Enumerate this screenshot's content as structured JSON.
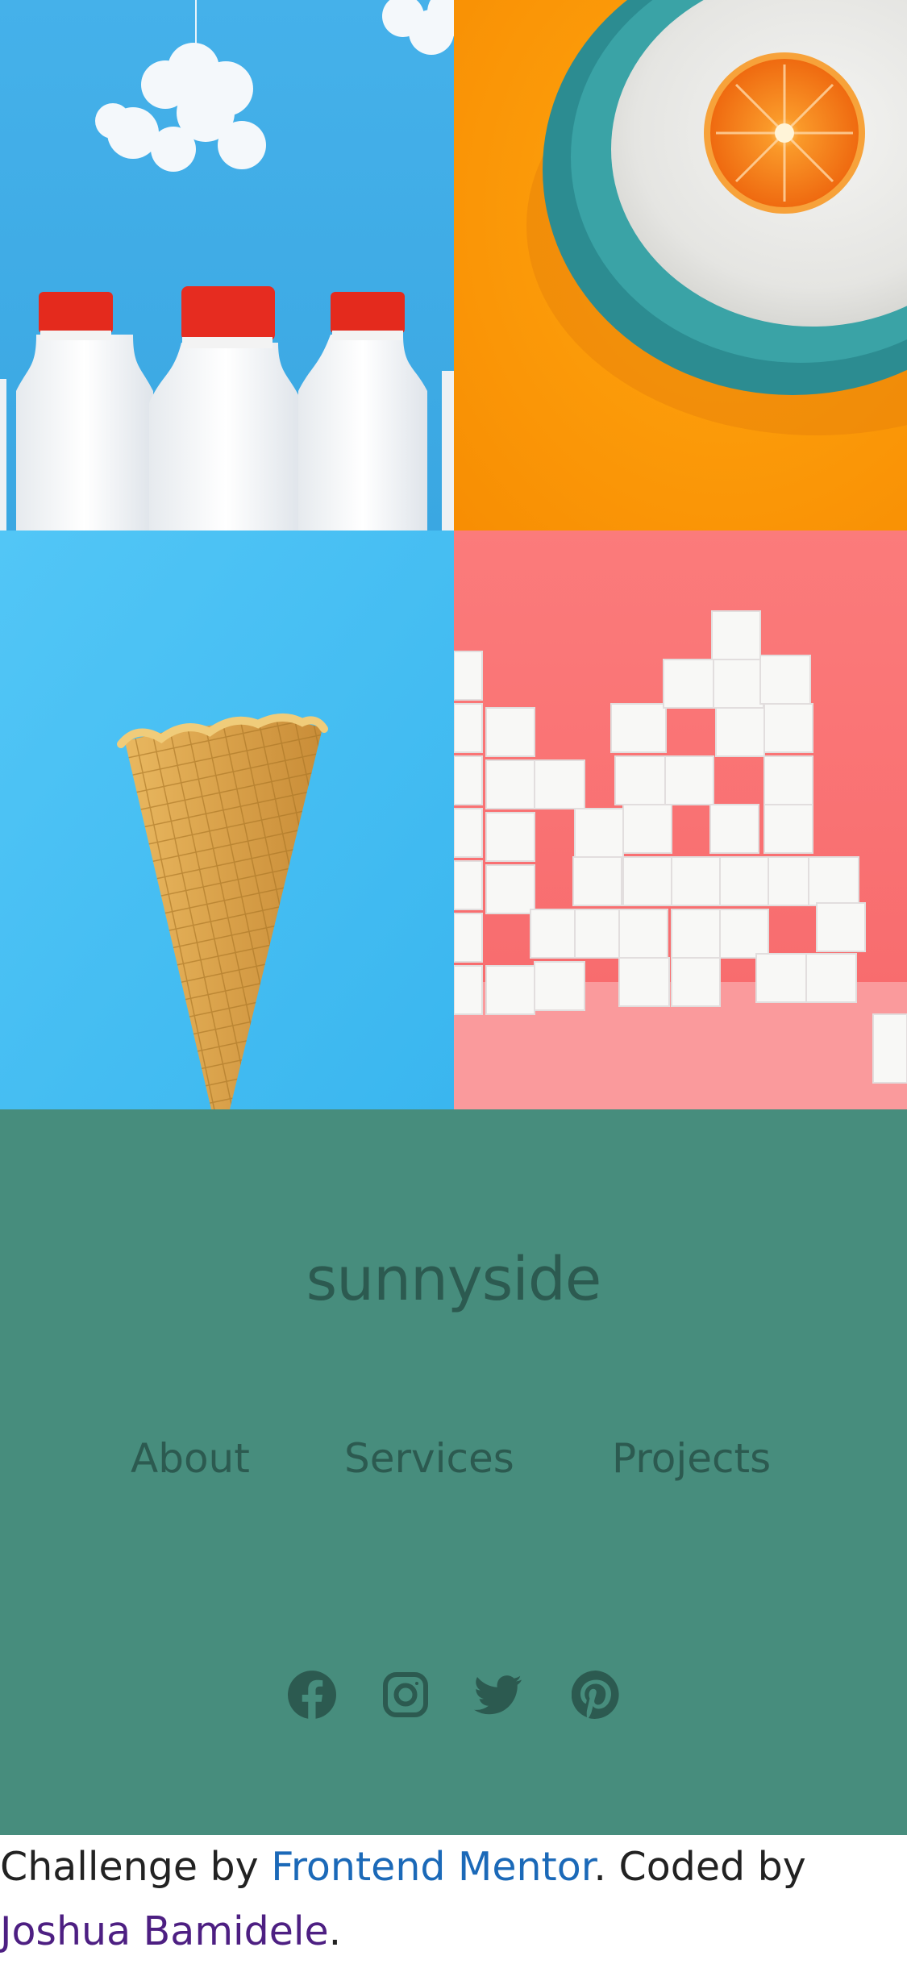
{
  "gallery": {
    "tiles": [
      {
        "name": "milk-bottles",
        "bg": "#3eaee8"
      },
      {
        "name": "orange",
        "bg": "#fb9a05"
      },
      {
        "name": "ice-cream-cone",
        "bg": "#4ac0f3"
      },
      {
        "name": "sugar-cubes",
        "bg": "#fa7878"
      }
    ]
  },
  "footer": {
    "bg": "#478d7d",
    "brand": "sunnyside",
    "nav": [
      "About",
      "Services",
      "Projects"
    ],
    "socials": [
      "facebook-icon",
      "instagram-icon",
      "twitter-icon",
      "pinterest-icon"
    ]
  },
  "attribution": {
    "prefix": "Challenge by ",
    "fm_link": "Frontend Mentor",
    "middle": ". Coded by ",
    "author_link": "Joshua Bamidele",
    "suffix": "."
  }
}
